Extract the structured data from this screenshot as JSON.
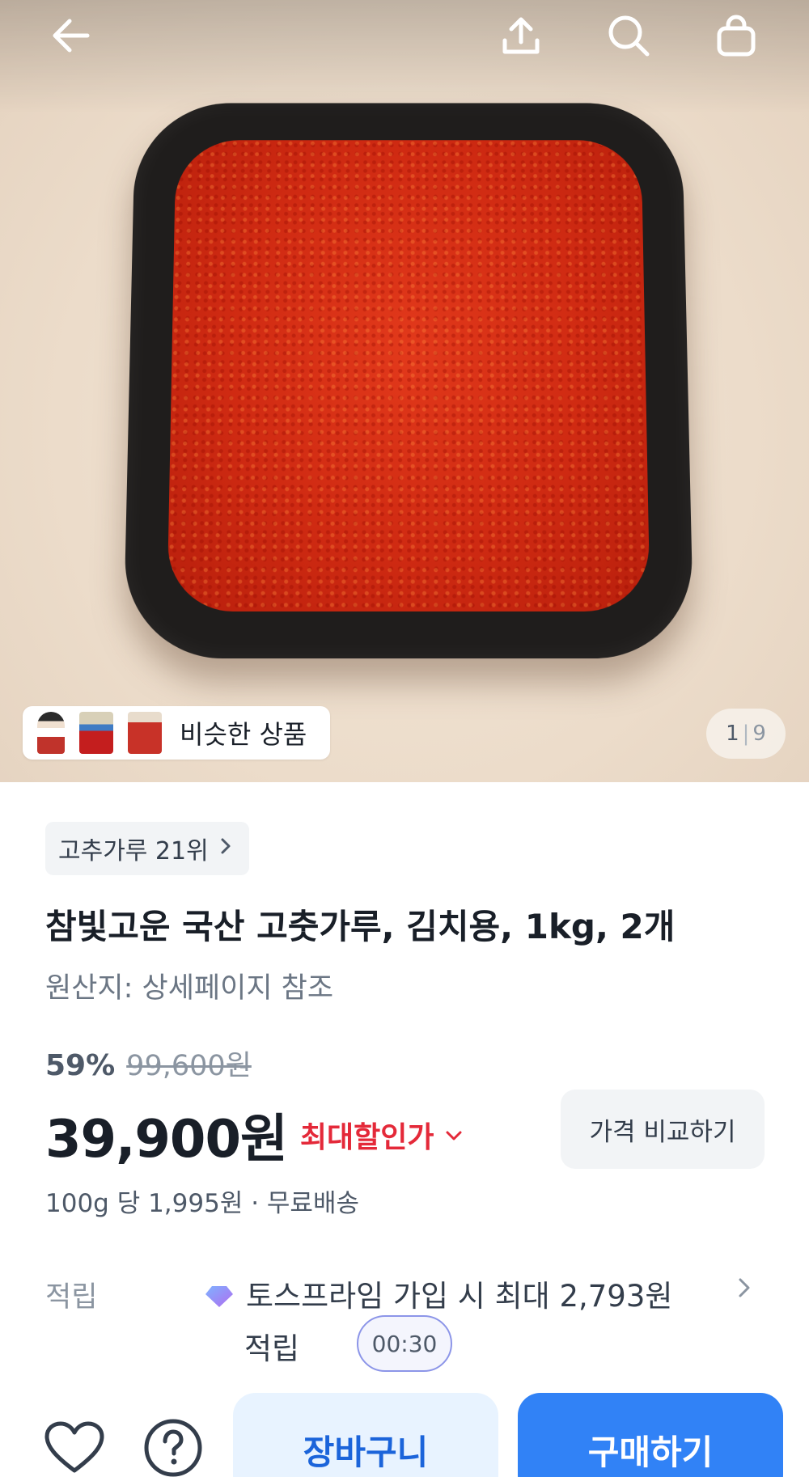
{
  "top_bar": {
    "back_icon": "arrow-left-icon",
    "share_icon": "share-icon",
    "search_icon": "search-icon",
    "cart_icon": "shopping-bag-icon"
  },
  "gallery": {
    "similar_label": "비슷한 상품",
    "current": "1",
    "separator": "|",
    "total": "9"
  },
  "product": {
    "rank_label": "고추가루 21위",
    "title": "참빛고운 국산 고춧가루, 김치용, 1kg, 2개",
    "origin": "원산지: 상세페이지 참조",
    "discount_rate": "59%",
    "original_price": "99,600원",
    "price": "39,900원",
    "max_discount_label": "최대할인가",
    "compare_label": "가격 비교하기",
    "unit_price": "100g 당 1,995원 · 무료배송"
  },
  "points": {
    "label": "적립",
    "line1": "토스프라임 가입 시 최대 2,793원",
    "line2": "적립",
    "timer": "00:30"
  },
  "bottom_bar": {
    "cart_label": "장바구니",
    "buy_label": "구매하기",
    "wish_icon": "heart-icon",
    "help_icon": "question-icon"
  },
  "colors": {
    "accent": "#3182f6",
    "discount_red": "#e42939",
    "cart_bg": "#e8f3ff"
  }
}
